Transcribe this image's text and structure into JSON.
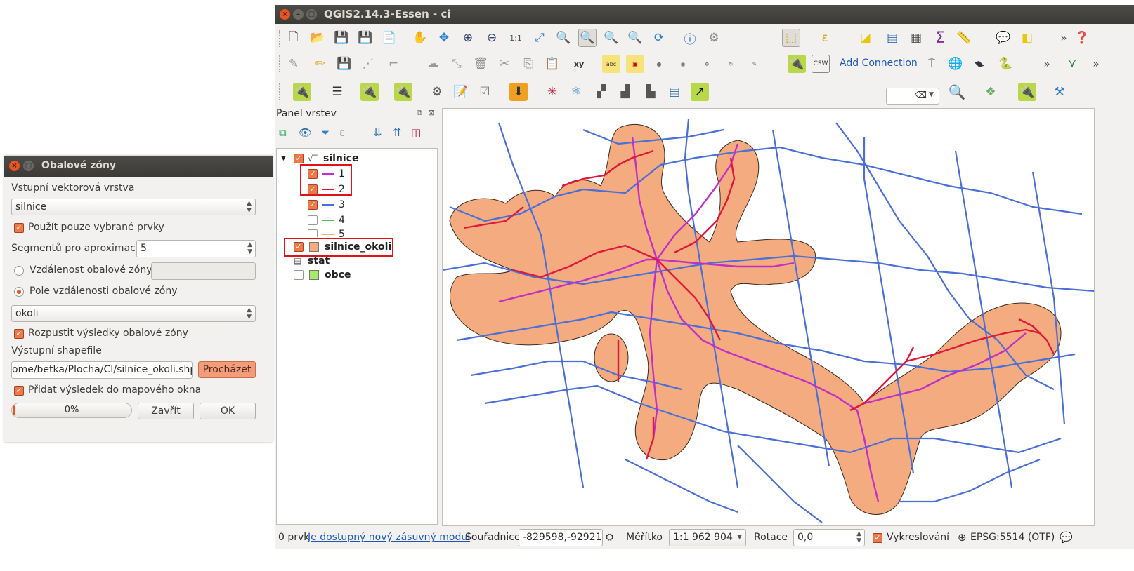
{
  "buffer_dialog": {
    "title": "Obalové zóny",
    "input_layer_label": "Vstupní vektorová vrstva",
    "input_layer_value": "silnice",
    "use_selected_label": "Použít pouze vybrané prvky",
    "segments_label": "Segmentů pro aproximaci",
    "segments_value": "5",
    "buffer_distance_label": "Vzdálenost obalové zóny",
    "buffer_field_label": "Pole vzdálenosti obalové zóny",
    "buffer_field_value": "okoli",
    "dissolve_label": "Rozpustit výsledky obalové zóny",
    "output_label": "Výstupní shapefile",
    "output_value": "ome/betka/Plocha/CI/silnice_okoli.shp",
    "browse_label": "Procházet",
    "add_to_map_label": "Přidat výsledek do mapového okna",
    "progress_text": "0%",
    "progress_value": 0.0,
    "close_label": "Zavřít",
    "ok_label": "OK"
  },
  "qgis": {
    "title": "QGIS2.14.3-Essen - ci",
    "add_connection_label": "Add Connection",
    "csw_label": "CSW",
    "xy_label": "xy",
    "abc_label": "abc",
    "layers_panel": {
      "title": "Panel vrstev",
      "layers": [
        {
          "name": "silnice",
          "checked": true,
          "classes": [
            {
              "label": "1",
              "color": "#c030c8",
              "checked": true
            },
            {
              "label": "2",
              "color": "#e0183a",
              "checked": true
            },
            {
              "label": "3",
              "color": "#4a6fd8",
              "checked": true
            },
            {
              "label": "4",
              "color": "#4fc04a",
              "checked": false
            },
            {
              "label": "5",
              "color": "#e8b65a",
              "checked": false
            }
          ]
        },
        {
          "name": "silnice_okoli",
          "checked": true,
          "color": "#f3ab7f"
        },
        {
          "name": "stat"
        },
        {
          "name": "obce",
          "checked": false,
          "color": "#a8e86a"
        }
      ]
    },
    "status": {
      "features": "0 prvk",
      "plugin_link": "Je dostupný nový zásuvný modul",
      "coord_label": "Souřadnice",
      "coord_value": "-829598,-929212",
      "scale_label": "Měřítko",
      "scale_value": "1:1 962 904",
      "rotation_label": "Rotace",
      "rotation_value": "0,0",
      "render_label": "Vykreslování",
      "crs": "EPSG:5514 (OTF)"
    },
    "colors": {
      "buffer_fill": "#f3ab7f",
      "road_class1": "#c030c8",
      "road_class2": "#e0183a",
      "road_class3": "#4a6fd8",
      "accent": "#e95420"
    }
  }
}
